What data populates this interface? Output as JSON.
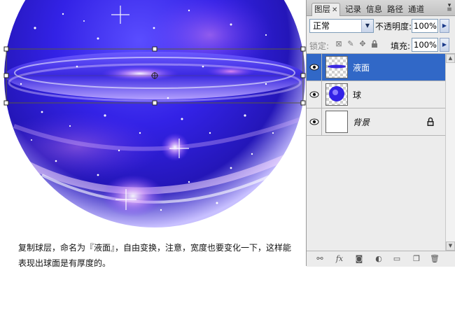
{
  "caption": {
    "line1": "复制球层，命名为『液面』，自由变换，注意，宽度也要变化一下，这样能",
    "line2": "表现出球面是有厚度的。"
  },
  "panel": {
    "tabs": [
      {
        "label": "图层",
        "active": true
      },
      {
        "label": "记录",
        "active": false
      },
      {
        "label": "信息",
        "active": false
      },
      {
        "label": "路径",
        "active": false
      },
      {
        "label": "通道",
        "active": false
      }
    ],
    "blend_mode": "正常",
    "opacity_label": "不透明度:",
    "opacity_value": "100%",
    "lock_label": "锁定:",
    "fill_label": "填充:",
    "fill_value": "100%",
    "layers": [
      {
        "name": "液面",
        "selected": true,
        "visible": true
      },
      {
        "name": "球",
        "selected": false,
        "visible": true
      },
      {
        "name": "背景",
        "selected": false,
        "visible": true,
        "locked": true
      }
    ],
    "bottom_icons": [
      "link-icon",
      "fx-icon",
      "mask-icon",
      "adjustment-icon",
      "folder-icon",
      "new-layer-icon",
      "trash-icon"
    ]
  },
  "colors": {
    "selection": "#3168c7",
    "sphere_core": "#2a1ad8",
    "sphere_edge": "#140a8a"
  }
}
